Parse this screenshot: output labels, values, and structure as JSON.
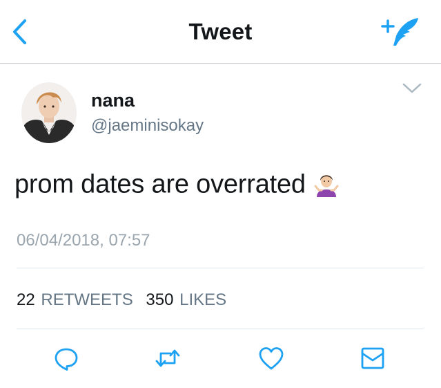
{
  "header": {
    "title": "Tweet",
    "back_icon": "chevron-left-icon",
    "compose_icon": "feather-plus-icon",
    "accent_color": "#1da1f2"
  },
  "author": {
    "name": "nana",
    "handle": "@jaeminisokay",
    "avatar_icon": "avatar-photo"
  },
  "tweet": {
    "text": "prom dates are overrated",
    "emoji": "person-shrugging-emoji",
    "timestamp": "06/04/2018, 07:57"
  },
  "stats": {
    "retweets_count": "22",
    "retweets_label": "RETWEETS",
    "likes_count": "350",
    "likes_label": "LIKES"
  },
  "actions": {
    "reply_icon": "reply-icon",
    "retweet_icon": "retweet-icon",
    "like_icon": "heart-icon",
    "dm_icon": "envelope-icon"
  }
}
